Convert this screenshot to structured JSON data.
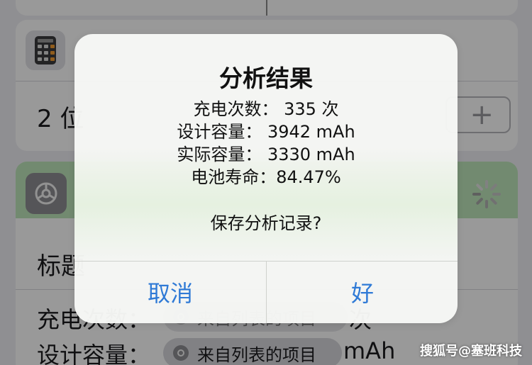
{
  "background": {
    "calculator_row": {
      "label": "2 位",
      "stepper_symbol": "+"
    },
    "settings_block": {
      "title_label": "标题",
      "row1": {
        "label": "充电次数：",
        "chip_text": "来自列表的项目",
        "suffix": "次"
      },
      "row2": {
        "label": "设计容量：",
        "chip_text": "来自列表的项目",
        "suffix": "mAh"
      }
    },
    "icons": {
      "calculator": "calculator-icon",
      "settings_app": "gear-icon",
      "spinner": "loading-spinner-icon",
      "chip": "gear-icon"
    },
    "colors": {
      "header_green": "#bfe6bb",
      "accent_blue": "#2f7ad6"
    }
  },
  "alert": {
    "title": "分析结果",
    "lines": [
      "充电次数： 335 次",
      "设计容量： 3942 mAh",
      "实际容量： 3330 mAh",
      "电池寿命：84.47%"
    ],
    "question": "保存分析记录?",
    "buttons": {
      "cancel": "取消",
      "ok": "好"
    }
  },
  "watermark": "搜狐号@塞班科技"
}
